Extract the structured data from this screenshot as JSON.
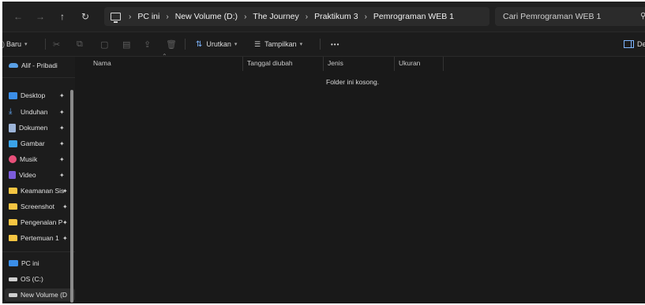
{
  "nav": {
    "back_icon": "arrow-left-icon",
    "forward_icon": "arrow-right-icon",
    "up_icon": "arrow-up-icon",
    "refresh_icon": "refresh-icon"
  },
  "breadcrumb": [
    "PC ini",
    "New Volume (D:)",
    "The Journey",
    "Praktikum 3",
    "Pemrograman WEB 1"
  ],
  "search": {
    "placeholder": "Cari Pemrograman WEB 1"
  },
  "toolbar": {
    "new_label": "Baru",
    "sort_label": "Urutkan",
    "view_label": "Tampilkan",
    "more_label": "•••",
    "details_label": "Deta"
  },
  "sidebar": {
    "onedrive": "Alif - Pribadi",
    "quick_access": [
      {
        "label": "Desktop",
        "icon": "desktop-icon"
      },
      {
        "label": "Unduhan",
        "icon": "download-icon"
      },
      {
        "label": "Dokumen",
        "icon": "documents-icon"
      },
      {
        "label": "Gambar",
        "icon": "pictures-icon"
      },
      {
        "label": "Musik",
        "icon": "music-icon"
      },
      {
        "label": "Video",
        "icon": "video-icon"
      },
      {
        "label": "Keamanan Sis",
        "icon": "folder-icon"
      },
      {
        "label": "Screenshot",
        "icon": "folder-icon"
      },
      {
        "label": "Pengenalan P",
        "icon": "folder-icon"
      },
      {
        "label": "Pertemuan 1",
        "icon": "folder-icon"
      }
    ],
    "this_pc": "PC ini",
    "drives": [
      {
        "label": "OS (C:)",
        "icon": "drive-icon"
      },
      {
        "label": "New Volume (D",
        "icon": "drive-icon"
      }
    ]
  },
  "columns": {
    "name": "Nama",
    "date": "Tanggal diubah",
    "type": "Jenis",
    "size": "Ukuran"
  },
  "empty_message": "Folder ini kosong.",
  "colors": {
    "background": "#1c1c1c",
    "accent": "#3b8ee8",
    "folder": "#f5c542"
  }
}
